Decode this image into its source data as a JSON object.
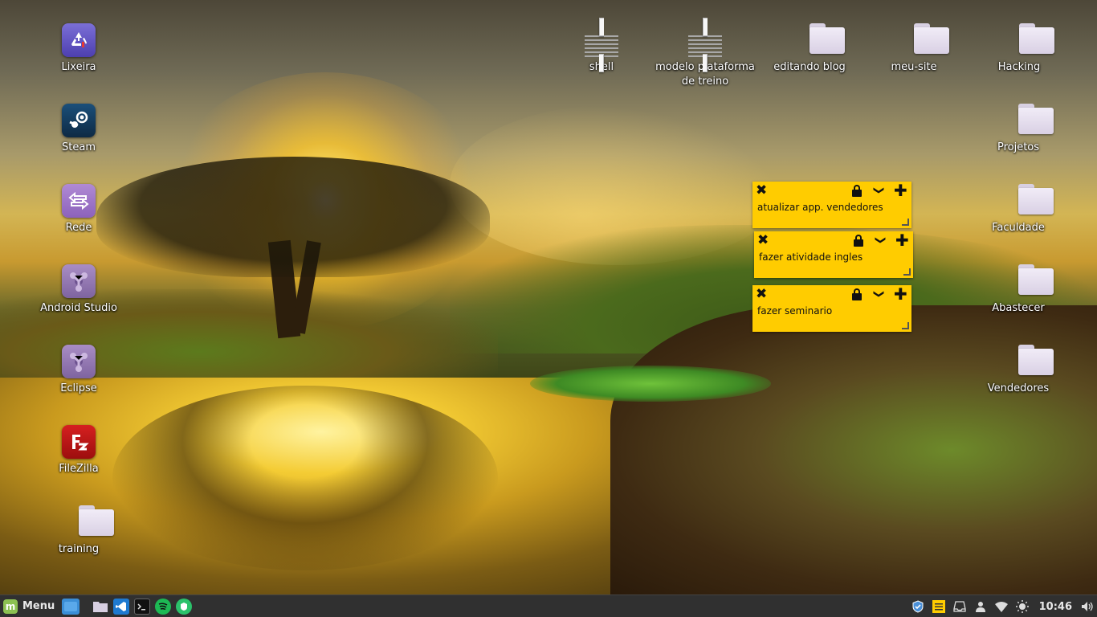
{
  "desktop": {
    "left_icons": [
      {
        "label": "Lixeira",
        "icon": "trash-icon"
      },
      {
        "label": "Steam",
        "icon": "steam-icon"
      },
      {
        "label": "Rede",
        "icon": "network-icon"
      },
      {
        "label": "Android Studio",
        "icon": "android-studio-icon"
      },
      {
        "label": "Eclipse",
        "icon": "eclipse-icon"
      },
      {
        "label": "FileZilla",
        "icon": "filezilla-icon"
      },
      {
        "label": "training",
        "icon": "folder-icon"
      }
    ],
    "top_icons": [
      {
        "label": "shell",
        "icon": "text-file-icon"
      },
      {
        "label": "modelo plataforma de treino",
        "icon": "text-file-icon"
      },
      {
        "label": "editando blog",
        "icon": "folder-icon"
      },
      {
        "label": "meu-site",
        "icon": "folder-icon"
      },
      {
        "label": "Hacking",
        "icon": "folder-icon"
      }
    ],
    "right_icons": [
      {
        "label": "Projetos",
        "icon": "folder-icon"
      },
      {
        "label": "Faculdade",
        "icon": "folder-icon"
      },
      {
        "label": "Abastecer",
        "icon": "folder-icon"
      },
      {
        "label": "Vendedores",
        "icon": "folder-icon"
      }
    ]
  },
  "sticky_notes": [
    {
      "text": "atualizar app. vendedores"
    },
    {
      "text": "fazer atividade ingles"
    },
    {
      "text": "fazer seminario"
    }
  ],
  "note_controls": {
    "close": "✖",
    "toggle": "❯",
    "add": "✚"
  },
  "taskbar": {
    "menu_label": "Menu",
    "menu_logo": "m",
    "launchers": [
      "show-desktop-icon",
      "files-icon",
      "vscode-icon",
      "terminal-icon",
      "spotify-icon",
      "vpn-icon"
    ],
    "tray": [
      "shield-icon",
      "sticky-notes-icon",
      "notifications-icon",
      "user-icon",
      "wifi-icon",
      "brightness-icon",
      "volume-icon"
    ],
    "clock": "10:46"
  },
  "colors": {
    "note_yellow": "#ffcc00",
    "taskbar_bg": "#303030",
    "mint_green": "#8cc152"
  }
}
